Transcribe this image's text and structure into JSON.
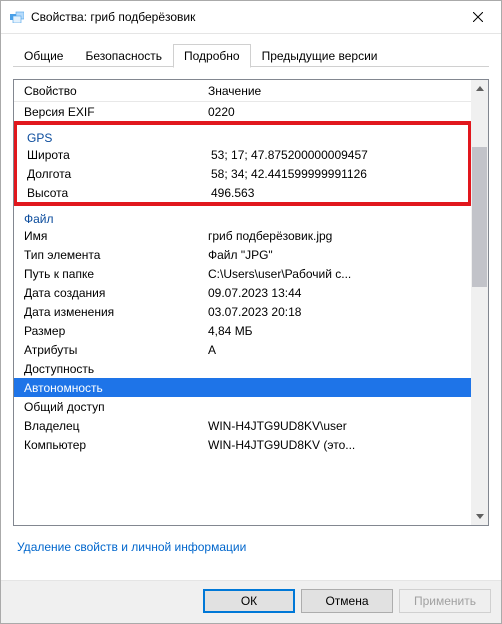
{
  "titlebar": {
    "title": "Свойства: гриб подберёзовик"
  },
  "tabs": {
    "general": "Общие",
    "security": "Безопасность",
    "details": "Подробно",
    "previous": "Предыдущие версии"
  },
  "headers": {
    "property": "Свойство",
    "value": "Значение"
  },
  "rows": {
    "exif_version_label": "Версия EXIF",
    "exif_version_value": "0220",
    "gps_group": "GPS",
    "latitude_label": "Широта",
    "latitude_value": "53; 17; 47.875200000009457",
    "longitude_label": "Долгота",
    "longitude_value": "58; 34; 42.441599999991126",
    "altitude_label": "Высота",
    "altitude_value": "496.563",
    "file_group": "Файл",
    "name_label": "Имя",
    "name_value": "гриб подберёзовик.jpg",
    "type_label": "Тип элемента",
    "type_value": "Файл \"JPG\"",
    "path_label": "Путь к папке",
    "path_value": "C:\\Users\\user\\Рабочий с...",
    "created_label": "Дата создания",
    "created_value": "09.07.2023 13:44",
    "modified_label": "Дата изменения",
    "modified_value": "03.07.2023 20:18",
    "size_label": "Размер",
    "size_value": "4,84 МБ",
    "attrs_label": "Атрибуты",
    "attrs_value": "A",
    "avail_label": "Доступность",
    "offline_label": "Автономность",
    "shared_label": "Общий доступ",
    "owner_label": "Владелец",
    "owner_value": "WIN-H4JTG9UD8KV\\user",
    "computer_label": "Компьютер",
    "computer_value": "WIN-H4JTG9UD8KV (это..."
  },
  "link": "Удаление свойств и личной информации",
  "buttons": {
    "ok": "ОК",
    "cancel": "Отмена",
    "apply": "Применить"
  }
}
